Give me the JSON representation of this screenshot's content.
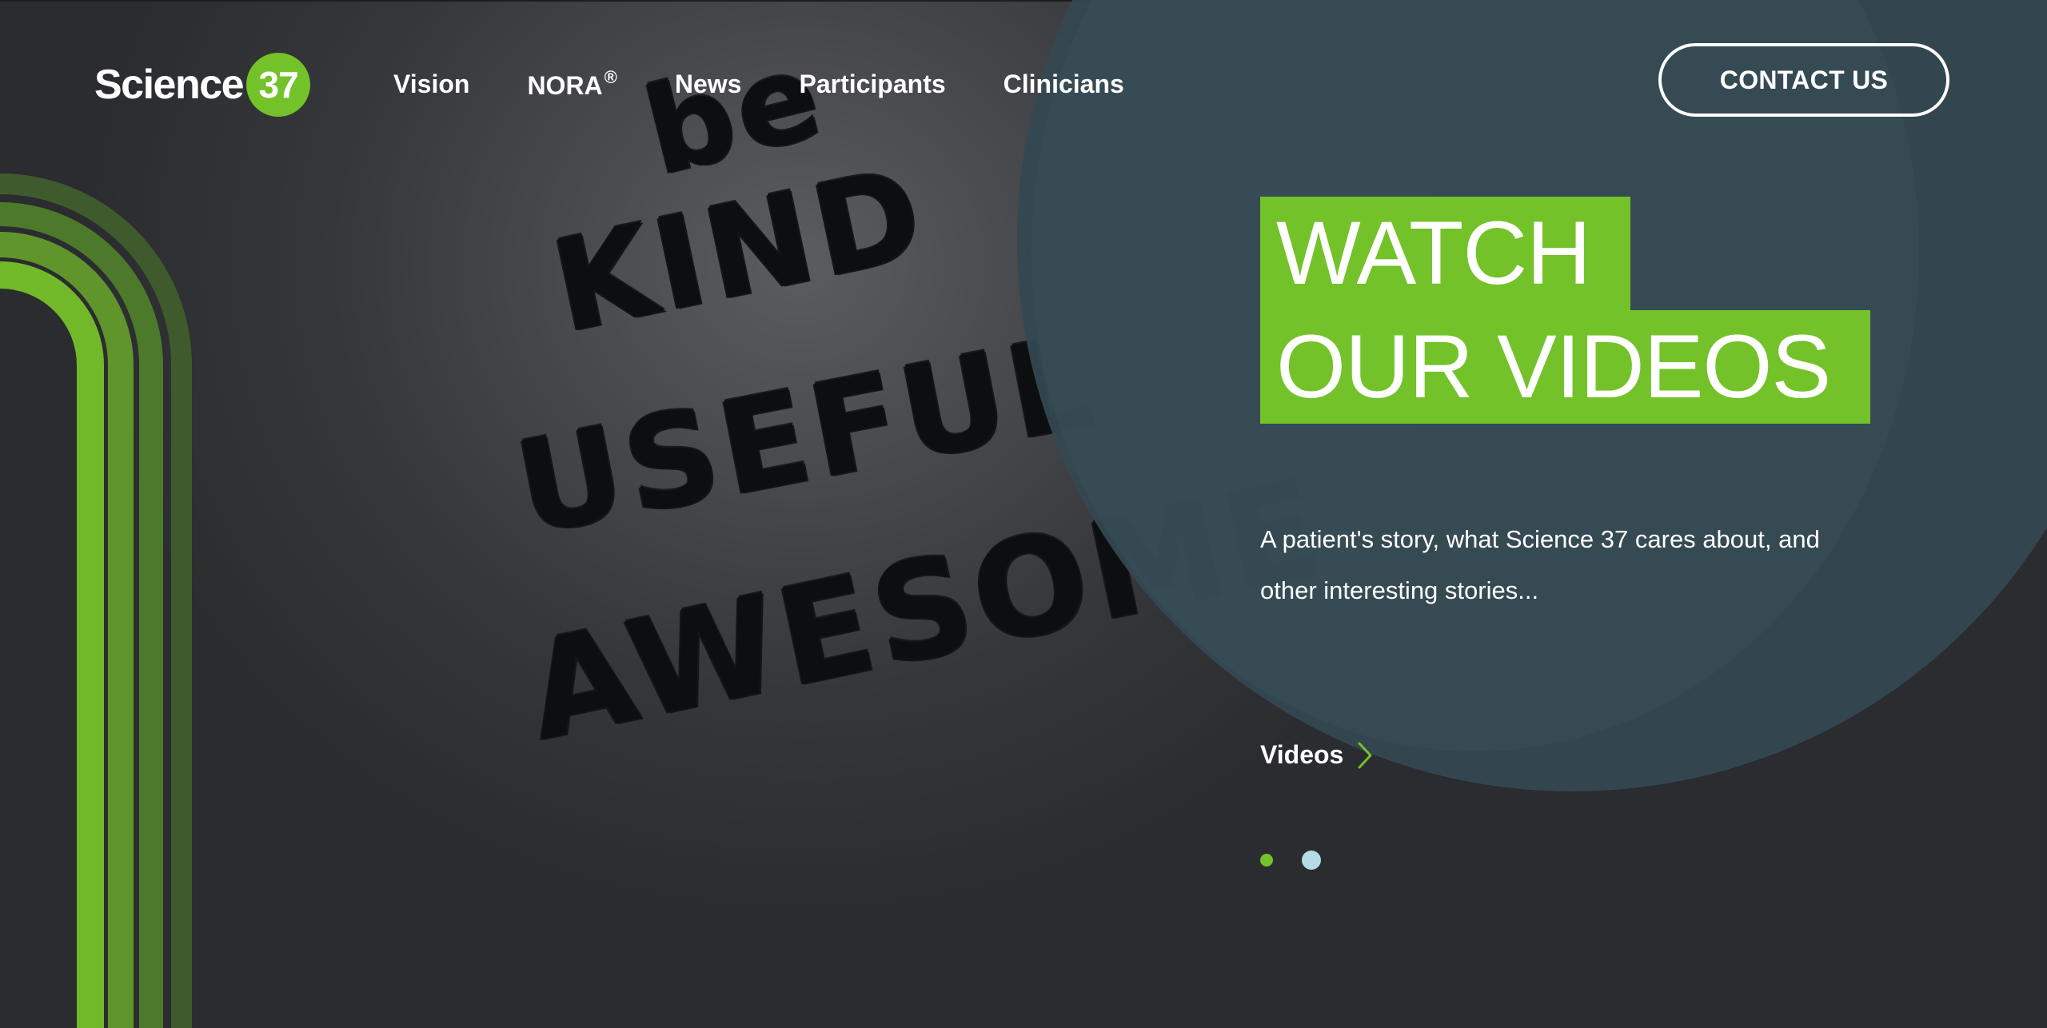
{
  "brand": {
    "logo_text": "Science",
    "logo_number": "37",
    "accent_color": "#74c22a"
  },
  "nav": {
    "items": [
      {
        "label": "Vision"
      },
      {
        "label": "NORA",
        "suffix": "®"
      },
      {
        "label": "News"
      },
      {
        "label": "Participants"
      },
      {
        "label": "Clinicians"
      }
    ]
  },
  "header": {
    "contact_label": "CONTACT US"
  },
  "background": {
    "wall_text": [
      "be",
      "KIND",
      "USEFUL",
      "AWESOME"
    ]
  },
  "slide": {
    "headline_line1": "WATCH",
    "headline_line2": "OUR VIDEOS",
    "description": "A patient's story, what Science 37 cares about, and other interesting stories...",
    "link_label": "Videos",
    "link_icon": "chevron-right-icon"
  },
  "carousel": {
    "slide_count": 2,
    "active_index": 0,
    "active_color": "#74c22a",
    "inactive_color": "#b6dbe6"
  }
}
